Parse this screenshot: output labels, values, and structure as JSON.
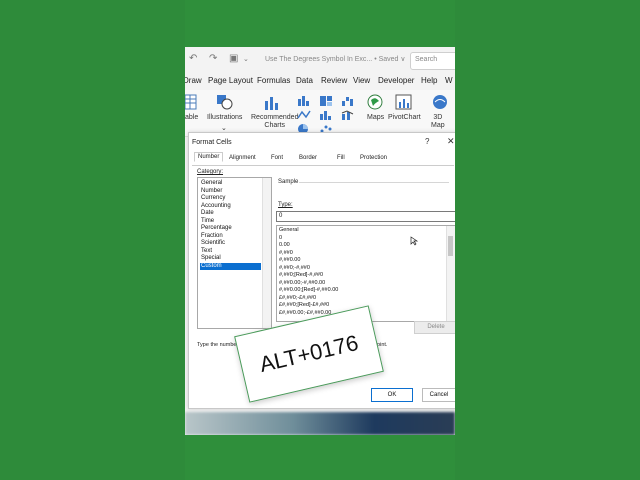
{
  "window": {
    "doc_title": "Use The Degrees Symbol In Exc... • Saved ∨",
    "search_placeholder": "Search"
  },
  "ribbon_tabs": [
    "Draw",
    "Page Layout",
    "Formulas",
    "Data",
    "Review",
    "View",
    "Developer",
    "Help",
    "W"
  ],
  "ribbon": {
    "table": "able",
    "illustrations": "Illustrations",
    "recommended_charts": "Recommended\nCharts",
    "maps": "Maps",
    "pivotchart": "PivotChart",
    "3d_map": "3D\nMap"
  },
  "dialog": {
    "title": "Format Cells",
    "help": "?",
    "close": "✕",
    "tabs": [
      "Number",
      "Alignment",
      "Font",
      "Border",
      "Fill",
      "Protection"
    ],
    "active_tab": "Number",
    "category_label": "Category:",
    "categories": [
      "General",
      "Number",
      "Currency",
      "Accounting",
      "Date",
      "Time",
      "Percentage",
      "Fraction",
      "Scientific",
      "Text",
      "Special",
      "Custom"
    ],
    "selected_category": "Custom",
    "sample_label": "Sample",
    "type_label": "Type:",
    "type_value": "0",
    "formats": [
      "General",
      "0",
      "0.00",
      "#,##0",
      "#,##0.00",
      "#,##0;-#,##0",
      "#,##0;[Red]-#,##0",
      "#,##0.00;-#,##0.00",
      "#,##0.00;[Red]-#,##0.00",
      "£#,##0;-£#,##0",
      "£#,##0;[Red]-£#,##0",
      "£#,##0.00;-£#,##0.00"
    ],
    "delete_label": "Delete",
    "hint": "Type the number fro",
    "hint_end": "point.",
    "ok_label": "OK",
    "cancel_label": "Cancel"
  },
  "overlay": {
    "card_text": "ALT+0176"
  }
}
